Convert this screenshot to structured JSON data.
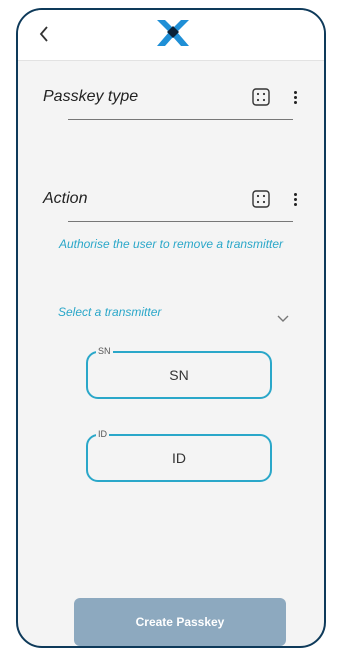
{
  "header": {
    "back_icon": "chevron-left-icon",
    "logo_icon": "app-logo-icon"
  },
  "passkey_type": {
    "label": "Passkey type",
    "keypad_icon": "keypad-icon",
    "menu_icon": "more-vertical-icon"
  },
  "action": {
    "label": "Action",
    "keypad_icon": "keypad-icon",
    "menu_icon": "more-vertical-icon",
    "hint": "Authorise the user to remove a transmitter"
  },
  "transmitter": {
    "select_label": "Select a transmitter",
    "chevron_icon": "chevron-down-icon"
  },
  "sn_field": {
    "legend": "SN",
    "placeholder": "SN"
  },
  "id_field": {
    "legend": "ID",
    "placeholder": "ID"
  },
  "create_button": {
    "label": "Create Passkey"
  },
  "colors": {
    "accent": "#2aa7c9",
    "button": "#8da9bf",
    "frame": "#0e3a5a",
    "logo_blue": "#1f8fd6",
    "logo_dark": "#0a2238"
  }
}
